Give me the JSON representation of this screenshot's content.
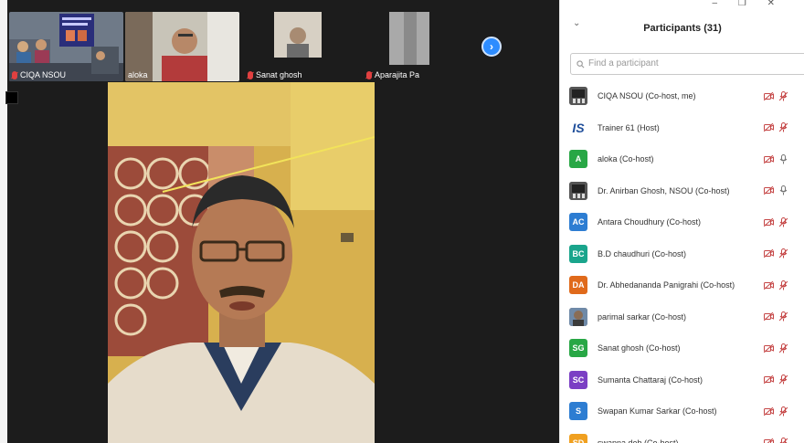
{
  "thumbnails": [
    {
      "label": "CIQA NSOU",
      "muted": true
    },
    {
      "label": "aloka",
      "muted": false
    },
    {
      "label": "Sanat ghosh",
      "muted": true
    },
    {
      "label": "Aparajita Pa",
      "muted": true
    }
  ],
  "window_controls": "– ❐ ✕",
  "panel": {
    "title": "Participants (31)",
    "search_placeholder": "Find a participant",
    "participants": [
      {
        "name": "CIQA NSOU (Co-host, me)",
        "avatar": "",
        "avatar_type": "room",
        "color": "#5a5a5a",
        "mic": "muted"
      },
      {
        "name": "Trainer 61 (Host)",
        "avatar": "IS",
        "avatar_type": "logo",
        "color": "#1f4e9a",
        "mic": "muted"
      },
      {
        "name": "aloka (Co-host)",
        "avatar": "A",
        "avatar_type": "initial",
        "color": "#28a745",
        "mic": "on"
      },
      {
        "name": "Dr. Anirban Ghosh, NSOU (Co-host)",
        "avatar": "",
        "avatar_type": "room",
        "color": "#5a5a5a",
        "mic": "on"
      },
      {
        "name": "Antara Choudhury (Co-host)",
        "avatar": "AC",
        "avatar_type": "initial",
        "color": "#2d7dd2",
        "mic": "muted"
      },
      {
        "name": "B.D chaudhuri (Co-host)",
        "avatar": "BC",
        "avatar_type": "initial",
        "color": "#1aa58c",
        "mic": "muted"
      },
      {
        "name": "Dr. Abhedananda Panigrahi (Co-host)",
        "avatar": "DA",
        "avatar_type": "initial",
        "color": "#e06a1b",
        "mic": "muted"
      },
      {
        "name": "parimal sarkar (Co-host)",
        "avatar": "",
        "avatar_type": "photo",
        "color": "#8a6d55",
        "mic": "muted"
      },
      {
        "name": "Sanat ghosh (Co-host)",
        "avatar": "SG",
        "avatar_type": "initial",
        "color": "#28a745",
        "mic": "muted"
      },
      {
        "name": "Sumanta Chattaraj (Co-host)",
        "avatar": "SC",
        "avatar_type": "initial",
        "color": "#7b3fc4",
        "mic": "muted"
      },
      {
        "name": "Swapan Kumar Sarkar (Co-host)",
        "avatar": "S",
        "avatar_type": "initial",
        "color": "#2d7dd2",
        "mic": "muted"
      },
      {
        "name": "swapna deb (Co-host)",
        "avatar": "SD",
        "avatar_type": "initial",
        "color": "#f0a020",
        "mic": "muted"
      }
    ]
  }
}
